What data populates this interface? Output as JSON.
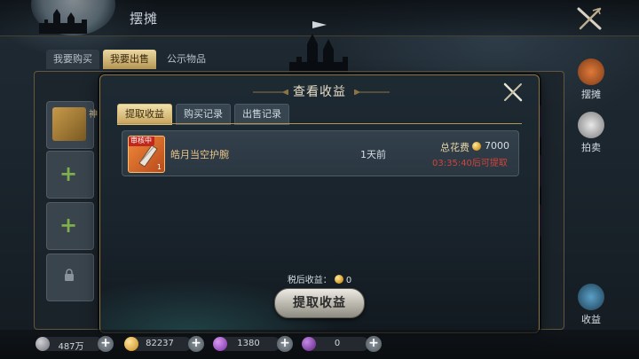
{
  "header": {
    "title": "摆摊"
  },
  "outer_tabs": [
    {
      "label": "我要购买"
    },
    {
      "label": "我要出售"
    },
    {
      "label": "公示物品"
    }
  ],
  "left_list": {
    "item_label": "神"
  },
  "side_menu": [
    {
      "label": "摆摊",
      "icon": "stall-icon"
    },
    {
      "label": "拍卖",
      "icon": "auction-icon"
    },
    {
      "label": "收益",
      "icon": "earnings-icon"
    }
  ],
  "modal": {
    "title": "查看收益",
    "tabs": [
      {
        "label": "提取收益"
      },
      {
        "label": "购买记录"
      },
      {
        "label": "出售记录"
      }
    ],
    "record": {
      "badge": "审核中",
      "count": "1",
      "name": "皓月当空护腕",
      "time": "1天前",
      "cost_label": "总花费",
      "cost_value": "7000",
      "countdown": "03:35:40后可提取"
    },
    "tax_label": "税后收益：",
    "tax_value": "0",
    "claim_button": "提取收益"
  },
  "currencies": [
    {
      "value": "487万",
      "icon": "silver-icon",
      "color": "#8e8e96"
    },
    {
      "value": "82237",
      "icon": "gold-coin-icon",
      "color": "#d9a53a"
    },
    {
      "value": "1380",
      "icon": "purple-gem-icon",
      "color": "#9b4fc4"
    },
    {
      "value": "0",
      "icon": "purple-gem-icon-2",
      "color": "#7e3fa8"
    }
  ],
  "colors": {
    "accent_gold": "#c7a35d",
    "countdown_red": "#d0443a",
    "border_gold": "#8a7445"
  }
}
